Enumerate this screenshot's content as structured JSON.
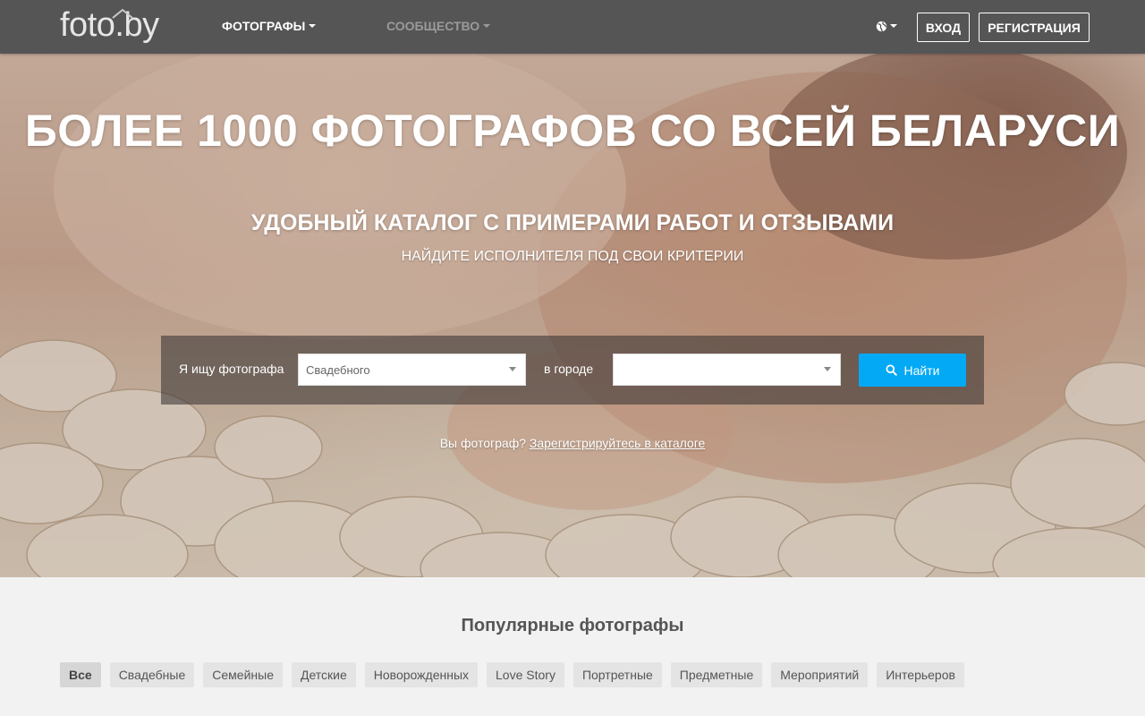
{
  "header": {
    "logo_text": "foto.by",
    "nav": [
      {
        "label": "Фотографы"
      },
      {
        "label": "Сообщество"
      }
    ],
    "login_label": "Вход",
    "register_label": "Регистрация"
  },
  "hero": {
    "title": "БОЛЕЕ 1000 ФОТОГРАФОВ СО ВСЕЙ БЕЛАРУСИ",
    "subtitle": "УДОБНЫЙ КАТАЛОГ С ПРИМЕРАМИ РАБОТ И ОТЗЫВАМИ",
    "tagline": "Найдите исполнителя под свои критерии",
    "search": {
      "label_type": "Я ищу фотографа",
      "type_value": "Свадебного",
      "label_city": "в городе",
      "city_value": "",
      "button_label": "Найти"
    },
    "register_prompt": "Вы фотограф?",
    "register_link": "Зарегистрируйтесь в каталоге"
  },
  "popular": {
    "title": "Популярные фотографы",
    "filters": [
      "Все",
      "Свадебные",
      "Семейные",
      "Детские",
      "Новорожденных",
      "Love Story",
      "Портретные",
      "Предметные",
      "Мероприятий",
      "Интерьеров"
    ],
    "active_filter": "Все"
  },
  "colors": {
    "navbar": "#555555",
    "accent": "#03a9f4",
    "page_bg": "#f2f2f2"
  }
}
